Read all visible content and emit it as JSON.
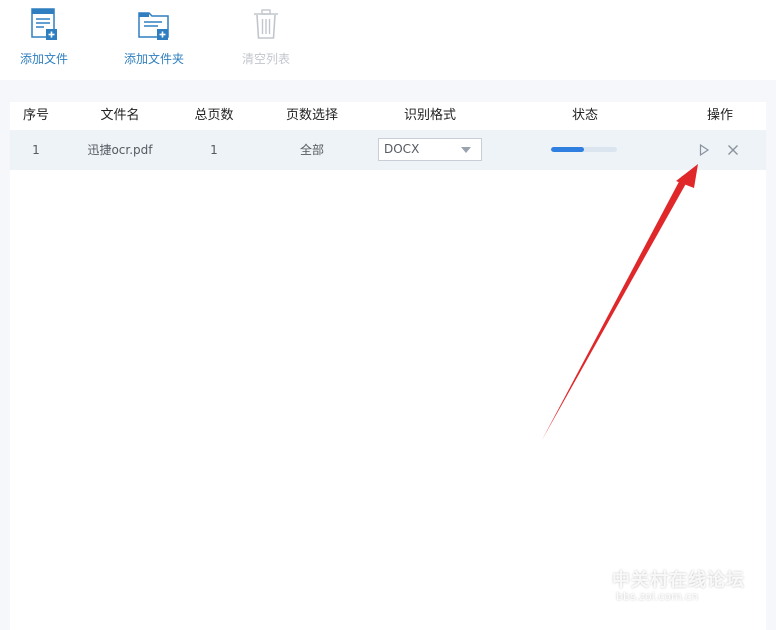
{
  "toolbar": {
    "add_file_label": "添加文件",
    "add_folder_label": "添加文件夹",
    "clear_list_label": "清空列表",
    "icons": {
      "add_file": "add-file-icon",
      "add_folder": "add-folder-icon",
      "clear_list": "trash-icon"
    }
  },
  "table": {
    "columns": [
      "序号",
      "文件名",
      "总页数",
      "页数选择",
      "识别格式",
      "状态",
      "操作"
    ],
    "rows": [
      {
        "index": "1",
        "filename": "迅捷ocr.pdf",
        "total_pages": "1",
        "page_selection": "全部",
        "format": "DOCX",
        "progress_percent": 50,
        "actions": [
          "play-icon",
          "close-icon"
        ]
      }
    ]
  },
  "watermark": {
    "title": "中关村在线论坛",
    "url": "bbs.zol.com.cn"
  },
  "colors": {
    "accent": "#2f7fc0",
    "progress": "#2f7fe0",
    "row_highlight": "#eef3f8",
    "annotation_arrow": "#e0282b"
  }
}
